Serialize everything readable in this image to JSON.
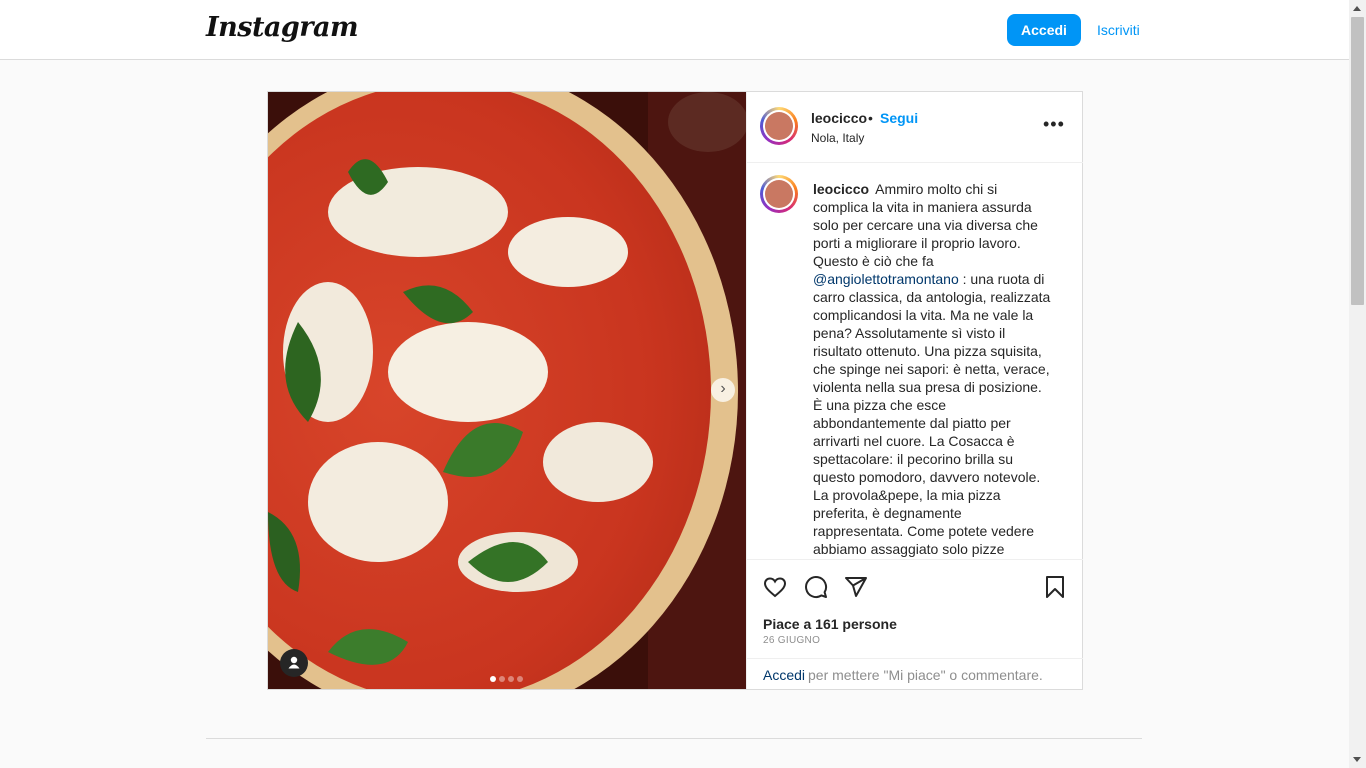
{
  "nav": {
    "logo": "Instagram",
    "login_label": "Accedi",
    "signup_label": "Iscriviti"
  },
  "post": {
    "username": "leocicco",
    "separator": "•",
    "follow_label": "Segui",
    "location": "Nola, Italy",
    "more_label": "•••",
    "caption_before_mention": "Ammiro molto chi si complica la vita in maniera assurda solo per cercare una via diversa che porti a migliorare il proprio lavoro. Questo è ciò che fa ",
    "mention": "@angiolettotramontano",
    "caption_after_mention": " : una ruota di carro classica, da antologia, realizzata complicandosi la vita. Ma ne vale la pena? Assolutamente sì visto il risultato ottenuto. Una pizza squisita, che spinge nei sapori: è netta, verace, violenta nella sua presa di posizione. È una pizza che esce abbondantemente dal piatto per arrivarti nel cuore. La Cosacca è spettacolare: il pecorino brilla su questo pomodoro, davvero notevole. La provola&pepe, la mia pizza preferita, è degnamente rappresentata. Come potete vedere abbiamo assaggiato solo pizze classiche ma quando sono fatte così",
    "likes": "Piace a 161 persone",
    "date": "26 GIUGNO",
    "login_prompt_link": "Accedi",
    "login_prompt_text": "per mettere \"Mi piace\" o commentare.",
    "carousel_next": "›"
  },
  "colors": {
    "accent": "#0095f6",
    "mention": "#00376b",
    "border": "#dbdbdb"
  },
  "icons": [
    "heart-icon",
    "comment-icon",
    "share-icon",
    "bookmark-icon",
    "user-tag-icon",
    "more-options-icon",
    "chevron-right-icon"
  ]
}
